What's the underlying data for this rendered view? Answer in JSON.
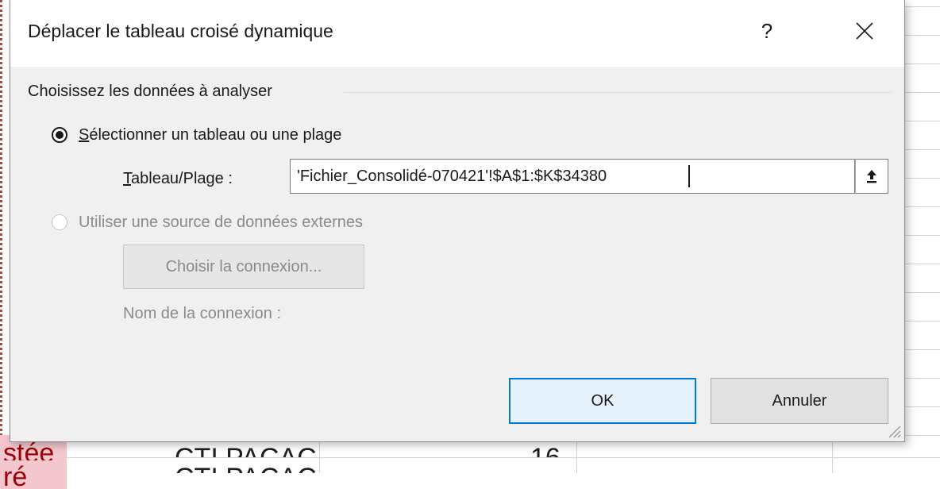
{
  "dialog": {
    "title": "Déplacer le tableau croisé dynamique",
    "help": "?",
    "group_label": "Choisissez les données à analyser",
    "option_table": {
      "accel": "S",
      "label_rest": "électionner un tableau ou une plage",
      "selected": true
    },
    "range": {
      "label_accel": "T",
      "label_rest": "ableau/Plage :",
      "value": "'Fichier_Consolidé-070421'!$A$1:$K$34380"
    },
    "option_external": {
      "label": "Utiliser une source de données externes",
      "selected": false
    },
    "choose_connection": "Choisir la connexion...",
    "connection_name": "Nom de la connexion :",
    "ok": "OK",
    "cancel": "Annuler"
  },
  "sheet": {
    "red_cell_1": "stée",
    "red_cell_2": "ré",
    "cell_b1": "CTI PACAC",
    "cell_b2": "CTI PACAC",
    "cell_d1": "16"
  },
  "colors": {
    "dialog_bg": "#f0f0f0",
    "accent": "#0078d7",
    "disabled_text": "#8a8a8a"
  }
}
